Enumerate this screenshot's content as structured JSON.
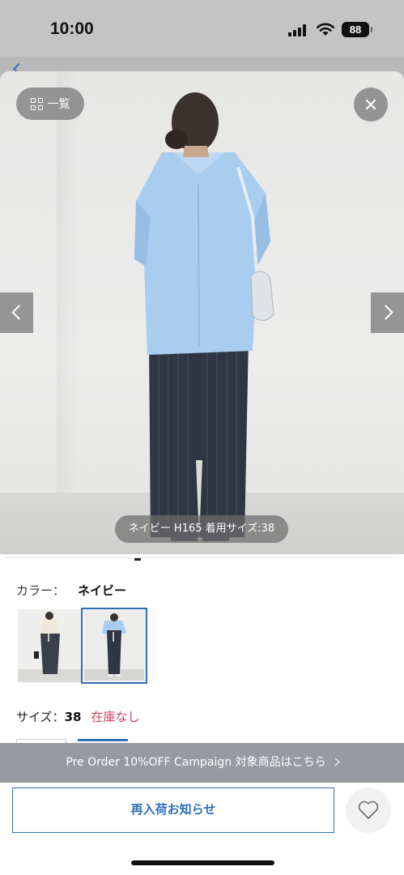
{
  "status_bar": {
    "time": "10:00",
    "battery": "88"
  },
  "gallery": {
    "list_label": "一覧",
    "caption": "ネイビー H165 着用サイズ:38",
    "icons": {
      "list": "grid-icon",
      "close": "close-icon",
      "prev": "chevron-left-icon",
      "next": "chevron-right-icon"
    }
  },
  "color": {
    "label": "カラー：",
    "selected": "ネイビー",
    "swatches": [
      {
        "name": "swatch-1",
        "selected": false
      },
      {
        "name": "swatch-navy",
        "selected": true
      }
    ]
  },
  "size": {
    "label": "サイズ：",
    "value": "38",
    "stock": "在庫なし"
  },
  "banner": {
    "text": "Pre Order 10%OFF Campaign 対象商品はこちら"
  },
  "actions": {
    "notify_label": "再入荷お知らせ",
    "favorite_icon": "heart-icon"
  },
  "colors": {
    "accent": "#2f6fb7",
    "stock_red": "#d0405a",
    "banner_bg": "#979aa0"
  }
}
